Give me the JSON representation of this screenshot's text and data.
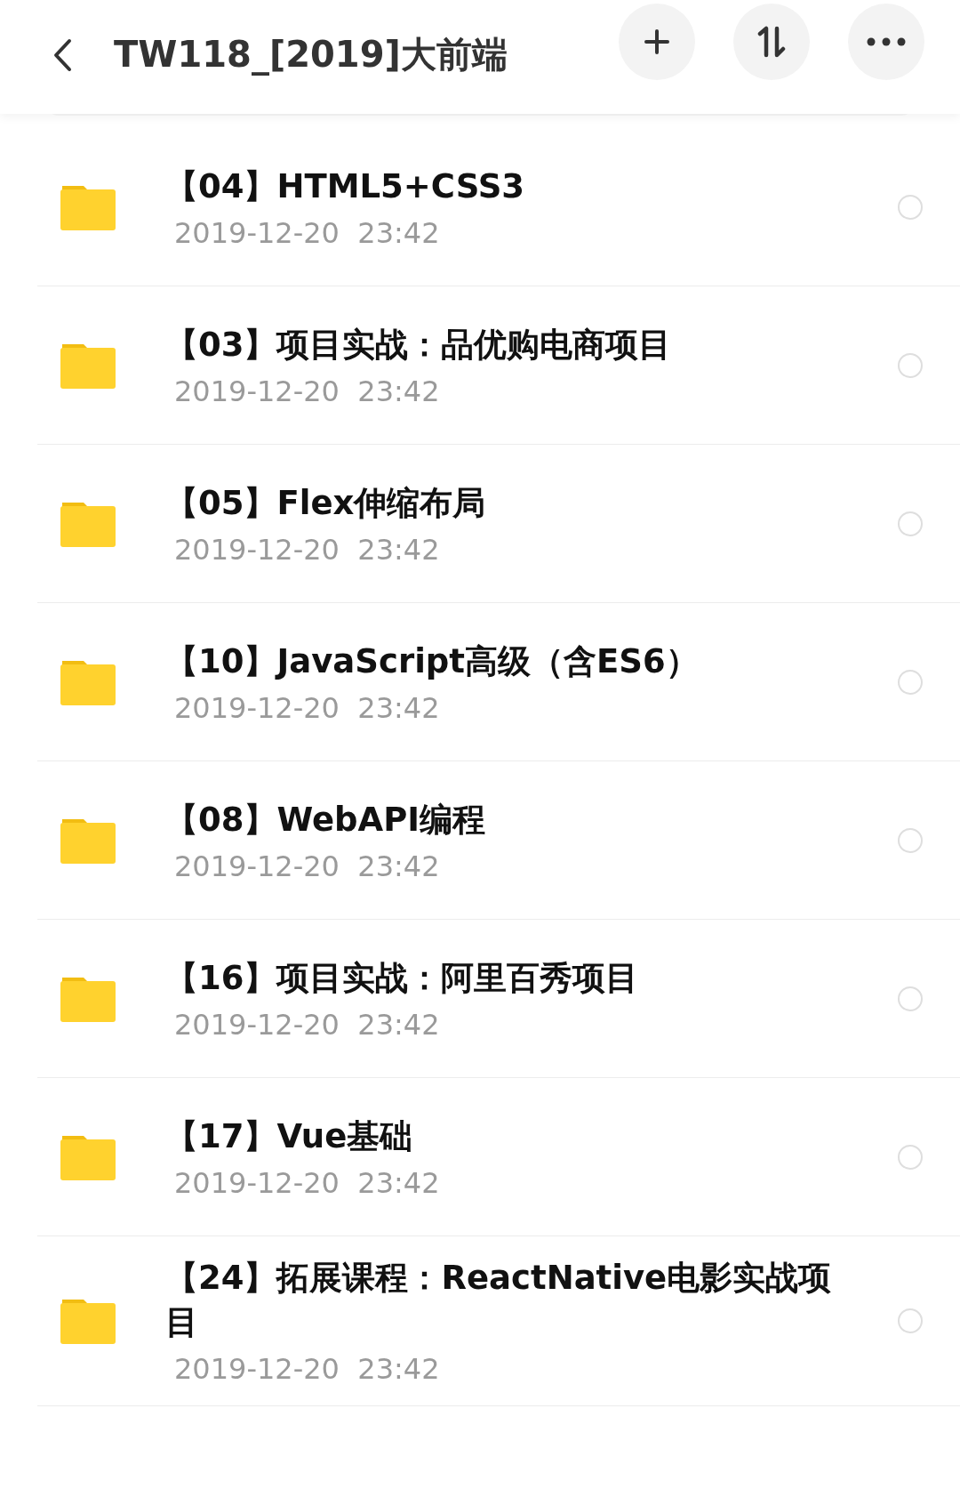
{
  "header": {
    "title": "TW118_[2019]大前端"
  },
  "folders": [
    {
      "name": "【04】HTML5+CSS3",
      "date": "2019-12-20  23:42",
      "selected": false
    },
    {
      "name": "【03】项目实战：品优购电商项目",
      "date": "2019-12-20  23:42",
      "selected": false
    },
    {
      "name": "【05】Flex伸缩布局",
      "date": "2019-12-20  23:42",
      "selected": false
    },
    {
      "name": "【10】JavaScript高级（含ES6）",
      "date": "2019-12-20  23:42",
      "selected": false
    },
    {
      "name": "【08】WebAPI编程",
      "date": "2019-12-20  23:42",
      "selected": false
    },
    {
      "name": "【16】项目实战：阿里百秀项目",
      "date": "2019-12-20  23:42",
      "selected": false
    },
    {
      "name": "【17】Vue基础",
      "date": "2019-12-20  23:42",
      "selected": false
    },
    {
      "name": "【24】拓展课程：ReactNative电影实战项目",
      "date": "2019-12-20  23:42",
      "selected": false
    }
  ]
}
